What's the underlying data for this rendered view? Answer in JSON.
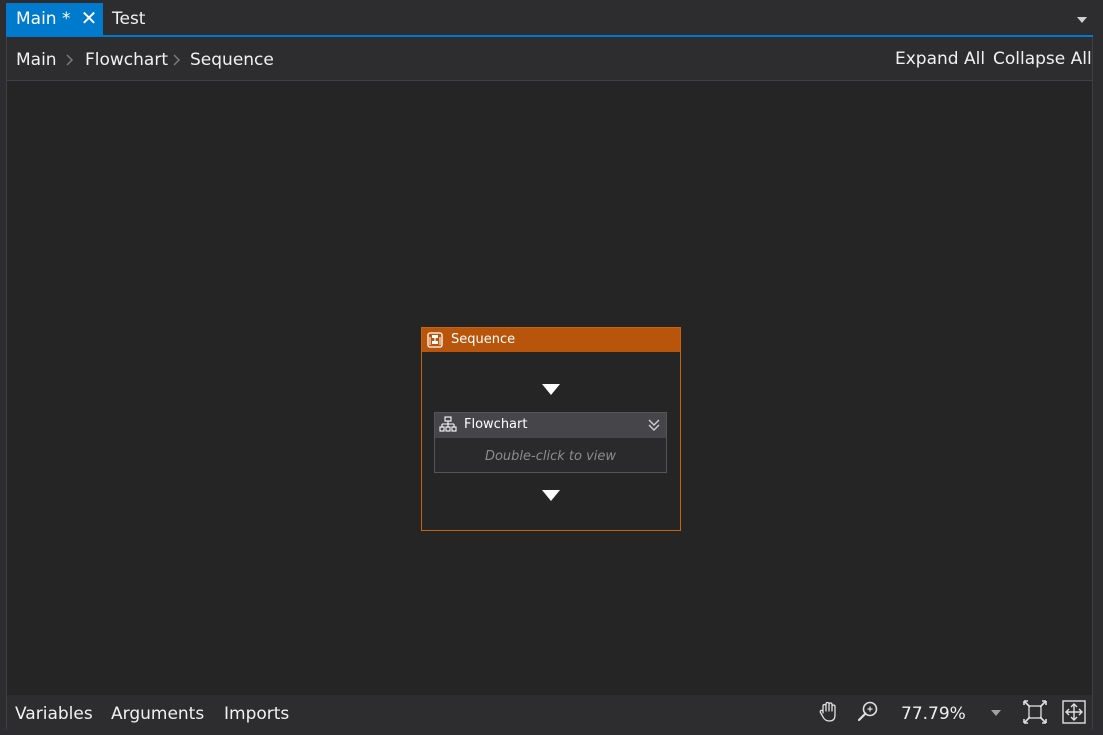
{
  "tabs": [
    {
      "label": "Main *",
      "active": true
    },
    {
      "label": "Test",
      "active": false
    }
  ],
  "breadcrumb": [
    "Main",
    "Flowchart",
    "Sequence"
  ],
  "actions": {
    "expand_all": "Expand All",
    "collapse_all": "Collapse All"
  },
  "sequence": {
    "title": "Sequence",
    "child": {
      "title": "Flowchart",
      "hint": "Double-click to view"
    }
  },
  "bottom": {
    "tabs": [
      "Variables",
      "Arguments",
      "Imports"
    ],
    "zoom": "77.79%"
  },
  "colors": {
    "accent": "#007acc",
    "sequence_header": "#b9550b",
    "sequence_border": "#c8630f",
    "background": "#252526"
  },
  "icons": [
    "close-icon",
    "dropdown-arrow-icon",
    "chevron-right-icon",
    "sequence-icon",
    "flowchart-icon",
    "expand-icon",
    "hand-pan-icon",
    "zoom-magnifier-icon",
    "fit-to-screen-icon",
    "reset-zoom-icon"
  ]
}
